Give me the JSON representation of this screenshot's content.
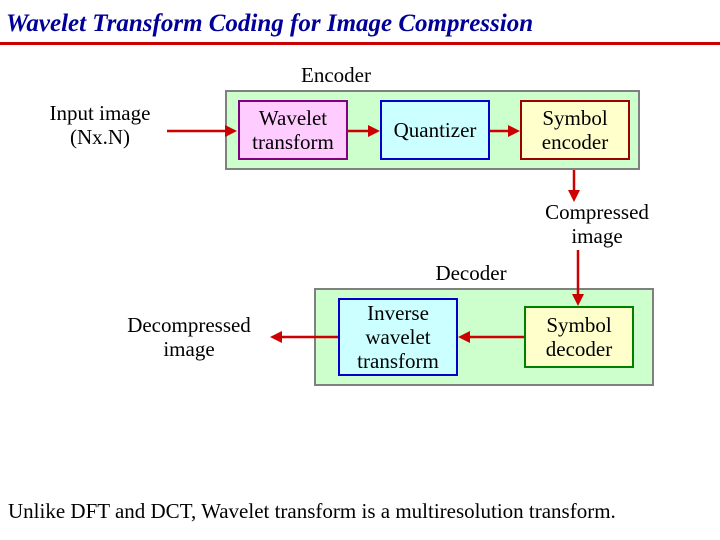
{
  "title": "Wavelet Transform Coding for Image Compression",
  "encoder": {
    "heading": "Encoder",
    "input": "Input image\n(Nx.N)",
    "blocks": {
      "wavelet": "Wavelet\ntransform",
      "quantizer": "Quantizer",
      "symbol": "Symbol\nencoder"
    }
  },
  "mid": {
    "compressed": "Compressed\nimage"
  },
  "decoder": {
    "heading": "Decoder",
    "output": "Decompressed\nimage",
    "blocks": {
      "inverse": "Inverse\nwavelet\ntransform",
      "symbol": "Symbol\ndecoder"
    }
  },
  "caption": "Unlike DFT and DCT, Wavelet transform is a multiresolution transform."
}
